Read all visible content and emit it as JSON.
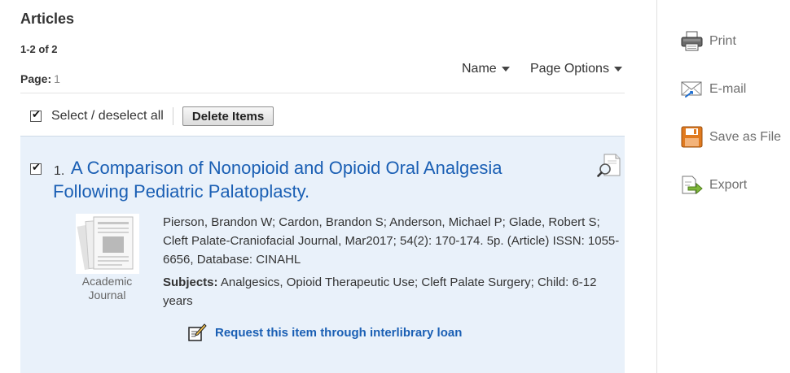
{
  "results": {
    "heading": "Articles",
    "count": "1-2 of 2",
    "page_label": "Page:",
    "page_number": "1",
    "sort_label": "Name",
    "page_options_label": "Page Options",
    "select_all_label": "Select / deselect all",
    "delete_button_label": "Delete Items"
  },
  "items": [
    {
      "number": "1.",
      "title": "A Comparison of Nonopioid and Opioid Oral Analgesia Following Pediatric Palatoplasty.",
      "pub_type_line1": "Academic",
      "pub_type_line2": "Journal",
      "citation": "Pierson, Brandon W; Cardon, Brandon S; Anderson, Michael P; Glade, Robert S; Cleft Palate-Craniofacial Journal, Mar2017; 54(2): 170-174. 5p. (Article) ISSN: 1055-6656, Database: CINAHL",
      "subjects_label": "Subjects:",
      "subjects": "Analgesics, Opioid Therapeutic Use; Cleft Palate Surgery; Child: 6-12 years",
      "ill_link": "Request this item through interlibrary loan",
      "checked": true
    }
  ],
  "tools": [
    {
      "label": "Print",
      "icon": "printer-icon"
    },
    {
      "label": "E-mail",
      "icon": "email-icon"
    },
    {
      "label": "Save as File",
      "icon": "floppy-disk-icon"
    },
    {
      "label": "Export",
      "icon": "export-icon"
    }
  ],
  "colors": {
    "link": "#1a5fb4",
    "result_background": "#e9f1fa",
    "tool_text": "#6e6e6e",
    "save_icon": "#e07a1f"
  }
}
